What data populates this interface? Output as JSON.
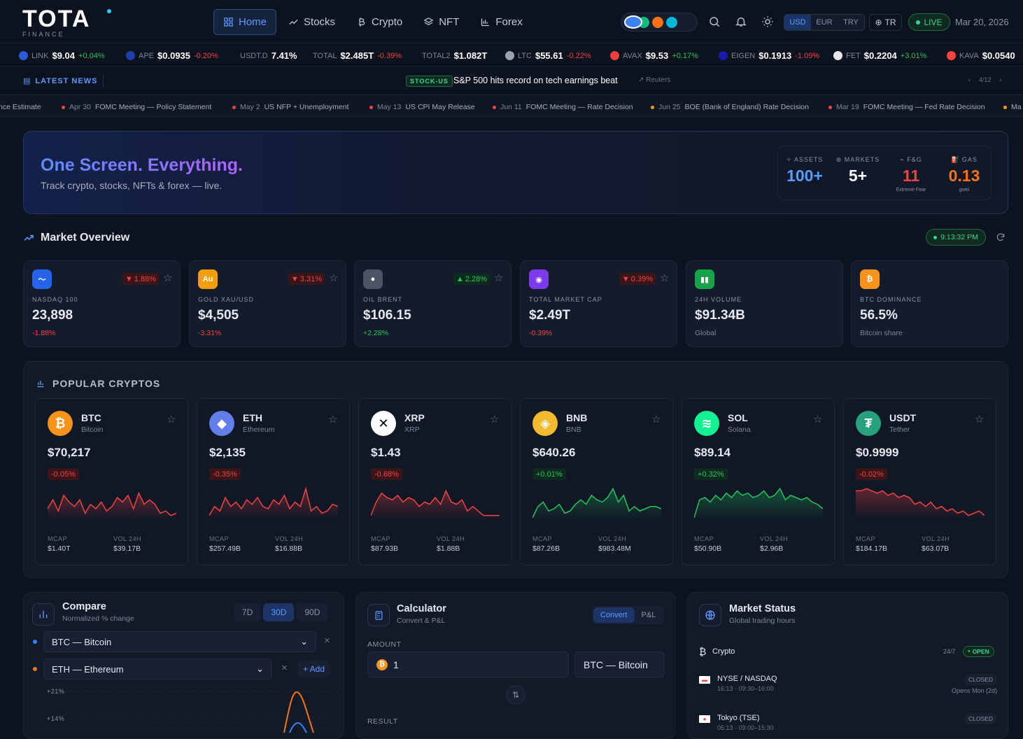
{
  "brand": {
    "logo_word": "TOTA",
    "logo_sub": "FINANCE"
  },
  "nav": [
    {
      "label": "Home",
      "icon": "grid-icon",
      "active": true
    },
    {
      "label": "Stocks",
      "icon": "trending-icon"
    },
    {
      "label": "Crypto",
      "icon": "bitcoin-icon"
    },
    {
      "label": "NFT",
      "icon": "layers-icon"
    },
    {
      "label": "Forex",
      "icon": "chart-icon"
    }
  ],
  "theme_colors": [
    "#3b82f6",
    "#8b5cf6",
    "#10b981",
    "#f97316",
    "#06b6d4"
  ],
  "currencies": [
    "USD",
    "EUR",
    "TRY"
  ],
  "language": "TR",
  "live_label": "LIVE",
  "date": "Mar 20, 2026",
  "ticker": [
    {
      "name": "LINK",
      "price": "$9.04",
      "change": "+0.04%",
      "dir": "up",
      "color": "#2a5ada"
    },
    {
      "name": "APE",
      "price": "$0.0935",
      "change": "-0.20%",
      "dir": "dn",
      "color": "#1e40af"
    },
    {
      "name": "USDT.D",
      "price": "7.41%",
      "change": "",
      "dir": "up",
      "color": ""
    },
    {
      "name": "TOTAL",
      "price": "$2.485T",
      "change": "-0.39%",
      "dir": "dn",
      "color": ""
    },
    {
      "name": "TOTAL2",
      "price": "$1.082T",
      "change": "",
      "dir": "up",
      "color": ""
    },
    {
      "name": "LTC",
      "price": "$55.61",
      "change": "-0.22%",
      "dir": "dn",
      "color": "#9ca3af"
    },
    {
      "name": "AVAX",
      "price": "$9.53",
      "change": "+0.17%",
      "dir": "up",
      "color": "#e84142"
    },
    {
      "name": "EIGEN",
      "price": "$0.1913",
      "change": "-1.09%",
      "dir": "dn",
      "color": "#1a1aaf"
    },
    {
      "name": "FET",
      "price": "$0.2204",
      "change": "+3.01%",
      "dir": "up",
      "color": "#e5e7eb"
    },
    {
      "name": "KAVA",
      "price": "$0.0540",
      "change": "",
      "dir": "up",
      "color": "#ff433e"
    }
  ],
  "news": {
    "label": "LATEST NEWS",
    "tag": "STOCK-US",
    "headline": "S&P 500 hits record on tech earnings beat",
    "source": "Reuters",
    "page": "4/12"
  },
  "events": [
    {
      "date": "",
      "title": "nce Estimate",
      "color": "#ef4444"
    },
    {
      "date": "Apr 30",
      "title": "FOMC Meeting — Policy Statement",
      "color": "#ef4444"
    },
    {
      "date": "May 2",
      "title": "US NFP + Unemployment",
      "color": "#ef4444"
    },
    {
      "date": "May 13",
      "title": "US CPI May Release",
      "color": "#ef4444"
    },
    {
      "date": "Jun 11",
      "title": "FOMC Meeting — Rate Decision",
      "color": "#ef4444"
    },
    {
      "date": "Jun 25",
      "title": "BOE (Bank of England) Rate Decision",
      "color": "#f59e0b"
    },
    {
      "date": "Mar 19",
      "title": "FOMC Meeting — Fed Rate Decision",
      "color": "#ef4444"
    },
    {
      "date": "",
      "title": "Ma",
      "color": "#f59e0b"
    }
  ],
  "hero": {
    "title": "One Screen. Everything.",
    "tagline": "Track crypto, stocks, NFTs & forex — live.",
    "stats": [
      {
        "label": "ASSETS",
        "value": "100+",
        "extra": "",
        "color": "#5b9bff"
      },
      {
        "label": "MARKETS",
        "value": "5+",
        "extra": "",
        "color": "#ffffff"
      },
      {
        "label": "F&G",
        "value": "11",
        "extra": "Extreme Fear",
        "color": "#ef4444"
      },
      {
        "label": "GAS",
        "value": "0.13",
        "extra": "gwei",
        "color": "#f97316"
      }
    ]
  },
  "market_overview": {
    "title": "Market Overview",
    "time": "9:13:32 PM",
    "cards": [
      {
        "label": "NASDAQ 100",
        "value": "23,898",
        "change": "1.88%",
        "dir": "dn",
        "sub": "-1.88%",
        "icon_color": "#2563eb"
      },
      {
        "label": "GOLD XAU/USD",
        "value": "$4,505",
        "change": "3.31%",
        "dir": "dn",
        "sub": "-3.31%",
        "icon_color": "#f59e0b"
      },
      {
        "label": "OIL BRENT",
        "value": "$106.15",
        "change": "2.28%",
        "dir": "up",
        "sub": "+2.28%",
        "icon_color": "#4b5563"
      },
      {
        "label": "TOTAL MARKET CAP",
        "value": "$2.49T",
        "change": "0.39%",
        "dir": "dn",
        "sub": "-0.39%",
        "icon_color": "#7c3aed"
      },
      {
        "label": "24H VOLUME",
        "value": "$91.34B",
        "change": "",
        "dir": "",
        "sub": "Global",
        "icon_color": "#16a34a"
      },
      {
        "label": "BTC DOMINANCE",
        "value": "56.5%",
        "change": "",
        "dir": "",
        "sub": "Bitcoin share",
        "icon_color": "#f7931a"
      }
    ]
  },
  "popular": {
    "title": "POPULAR CRYPTOS",
    "coins": [
      {
        "symbol": "BTC",
        "name": "Bitcoin",
        "price": "$70,217",
        "change": "-0.05%",
        "dir": "dn",
        "mcap": "$1.40T",
        "vol": "$39.17B",
        "color": "#f7931a",
        "spark": [
          20,
          12,
          22,
          8,
          14,
          18,
          12,
          24,
          16,
          20,
          14,
          22,
          18,
          10,
          14,
          8,
          20,
          6,
          16,
          12,
          16,
          24,
          22,
          26,
          24
        ]
      },
      {
        "symbol": "ETH",
        "name": "Ethereum",
        "price": "$2,135",
        "change": "-0.35%",
        "dir": "dn",
        "mcap": "$257.49B",
        "vol": "$16.88B",
        "color": "#627eea",
        "spark": [
          26,
          18,
          22,
          10,
          18,
          14,
          20,
          12,
          16,
          10,
          18,
          20,
          12,
          16,
          8,
          20,
          14,
          18,
          2,
          22,
          18,
          24,
          22,
          16,
          18
        ]
      },
      {
        "symbol": "XRP",
        "name": "XRP",
        "price": "$1.43",
        "change": "-0.68%",
        "dir": "dn",
        "mcap": "$87.93B",
        "vol": "$1.88B",
        "color": "#ffffff",
        "spark": [
          26,
          14,
          6,
          10,
          12,
          8,
          14,
          10,
          12,
          18,
          14,
          16,
          10,
          16,
          4,
          14,
          16,
          12,
          22,
          18,
          22,
          26,
          26,
          26,
          26
        ]
      },
      {
        "symbol": "BNB",
        "name": "BNB",
        "price": "$640.26",
        "change": "+0.01%",
        "dir": "up",
        "mcap": "$87.26B",
        "vol": "$983.48M",
        "color": "#f3ba2f",
        "spark": [
          28,
          18,
          14,
          22,
          20,
          16,
          24,
          22,
          16,
          12,
          16,
          8,
          12,
          14,
          10,
          2,
          14,
          8,
          22,
          18,
          22,
          20,
          18,
          18,
          20
        ]
      },
      {
        "symbol": "SOL",
        "name": "Solana",
        "price": "$89.14",
        "change": "+0.32%",
        "dir": "up",
        "mcap": "$50.90B",
        "vol": "$2.96B",
        "color": "#14f195",
        "spark": [
          28,
          12,
          10,
          14,
          8,
          12,
          6,
          10,
          4,
          8,
          6,
          10,
          8,
          4,
          10,
          8,
          2,
          12,
          8,
          10,
          12,
          10,
          14,
          16,
          20
        ]
      },
      {
        "symbol": "USDT",
        "name": "Tether",
        "price": "$0.9999",
        "change": "-0.02%",
        "dir": "dn",
        "mcap": "$184.17B",
        "vol": "$63.07B",
        "color": "#26a17b",
        "spark": [
          4,
          4,
          2,
          4,
          6,
          4,
          8,
          6,
          10,
          8,
          10,
          16,
          14,
          18,
          14,
          20,
          18,
          22,
          20,
          24,
          22,
          26,
          24,
          22,
          26
        ]
      }
    ],
    "mcap_label": "MCAP",
    "vol_label": "VOL 24H"
  },
  "compare": {
    "title": "Compare",
    "subtitle": "Normalized % change",
    "ranges": [
      "7D",
      "30D",
      "90D"
    ],
    "active_range": "30D",
    "series": [
      {
        "label": "BTC — Bitcoin",
        "color": "#3b82f6"
      },
      {
        "label": "ETH — Ethereum",
        "color": "#f97316"
      }
    ],
    "add_label": "+ Add",
    "y_ticks": [
      "+21%",
      "+14%"
    ]
  },
  "calculator": {
    "title": "Calculator",
    "subtitle": "Convert & P&L",
    "tabs": [
      "Convert",
      "P&L"
    ],
    "amount_label": "AMOUNT",
    "amount": "1",
    "asset": "BTC — Bitcoin",
    "result_label": "RESULT"
  },
  "market_status": {
    "title": "Market Status",
    "subtitle": "Global trading hours",
    "rows": [
      {
        "name": "Crypto",
        "hours": "",
        "status": "OPEN",
        "note": "24/7",
        "flag": "bitcoin-icon"
      },
      {
        "name": "NYSE / NASDAQ",
        "hours": "16:13 · 09:30–16:00",
        "status": "CLOSED",
        "note": "Opens Mon (2d)",
        "flag": "us-flag-icon"
      },
      {
        "name": "Tokyo (TSE)",
        "hours": "05:13 · 09:00–15:30",
        "status": "CLOSED",
        "note": "",
        "flag": "jp-flag-icon"
      }
    ]
  }
}
